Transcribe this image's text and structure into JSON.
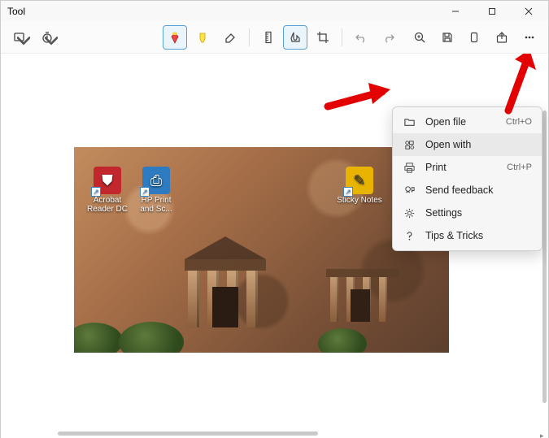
{
  "window": {
    "title": "Tool"
  },
  "toolbar": {
    "shape_tool": "shape",
    "timer_tool": "timer",
    "pen_tool": "pen",
    "highlighter_tool": "highlighter",
    "eraser_tool": "eraser",
    "ruler_tool": "ruler",
    "touch_tool": "touch-writing",
    "crop_tool": "crop",
    "undo_tool": "undo",
    "redo_tool": "redo",
    "zoom_tool": "zoom",
    "save_tool": "save",
    "copy_tool": "copy",
    "share_tool": "share",
    "more_tool": "more"
  },
  "desktop_icons": [
    {
      "label": "Acrobat Reader DC"
    },
    {
      "label": "HP Print and Sc..."
    },
    {
      "label": "Sticky Notes"
    }
  ],
  "menu": {
    "items": [
      {
        "icon": "folder-open-icon",
        "label": "Open file",
        "shortcut": "Ctrl+O"
      },
      {
        "icon": "open-with-icon",
        "label": "Open with",
        "shortcut": ""
      },
      {
        "icon": "print-icon",
        "label": "Print",
        "shortcut": "Ctrl+P"
      },
      {
        "icon": "feedback-icon",
        "label": "Send feedback",
        "shortcut": ""
      },
      {
        "icon": "settings-icon",
        "label": "Settings",
        "shortcut": ""
      },
      {
        "icon": "help-icon",
        "label": "Tips & Tricks",
        "shortcut": ""
      }
    ]
  }
}
